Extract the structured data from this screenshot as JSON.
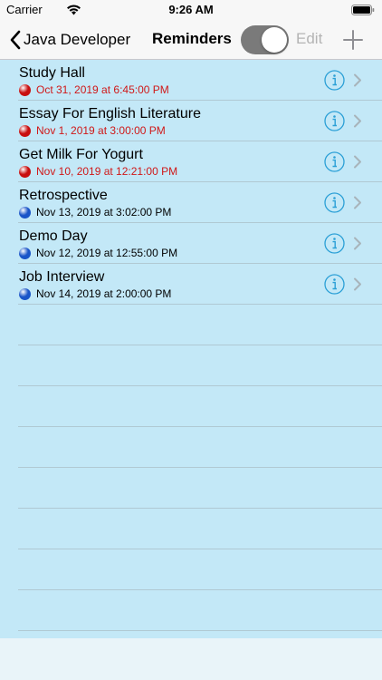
{
  "status_bar": {
    "carrier": "Carrier",
    "time": "9:26 AM"
  },
  "nav": {
    "back_label": "Java Developer",
    "title": "Reminders",
    "toggle_on": true,
    "edit_label": "Edit"
  },
  "colors": {
    "list_background": "#c3e8f7",
    "accent": "#2a9fd6",
    "overdue_text": "#d01818",
    "overdue_dot": "#c80f0f",
    "upcoming_dot": "#1a55c8",
    "toggle_track": "#7a7a7a"
  },
  "reminders": [
    {
      "title": "Study Hall",
      "date": "Oct 31, 2019 at 6:45:00 PM",
      "status": "overdue"
    },
    {
      "title": "Essay For English Literature",
      "date": "Nov 1, 2019 at 3:00:00 PM",
      "status": "overdue"
    },
    {
      "title": "Get Milk For Yogurt",
      "date": "Nov 10, 2019 at 12:21:00 PM",
      "status": "overdue"
    },
    {
      "title": "Retrospective",
      "date": "Nov 13, 2019 at 3:02:00 PM",
      "status": "upcoming"
    },
    {
      "title": "Demo Day",
      "date": "Nov 12, 2019 at 12:55:00 PM",
      "status": "upcoming"
    },
    {
      "title": "Job Interview",
      "date": "Nov 14, 2019 at 2:00:00 PM",
      "status": "upcoming"
    }
  ]
}
